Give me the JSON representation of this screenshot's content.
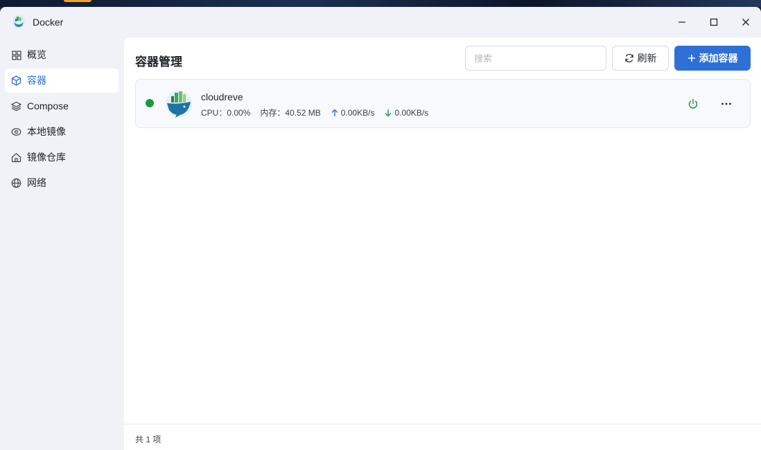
{
  "window": {
    "title": "Docker"
  },
  "sidebar": {
    "items": [
      {
        "label": "概览",
        "icon": "grid-icon",
        "active": false
      },
      {
        "label": "容器",
        "icon": "cube-icon",
        "active": true
      },
      {
        "label": "Compose",
        "icon": "layers-icon",
        "active": false
      },
      {
        "label": "本地镜像",
        "icon": "disc-icon",
        "active": false
      },
      {
        "label": "镜像仓库",
        "icon": "home-icon",
        "active": false
      },
      {
        "label": "网络",
        "icon": "globe-icon",
        "active": false
      }
    ]
  },
  "main": {
    "title": "容器管理",
    "search": {
      "placeholder": "搜索",
      "value": ""
    },
    "refresh_label": "刷新",
    "add_label": "添加容器"
  },
  "containers": [
    {
      "name": "cloudreve",
      "status": "running",
      "cpu": "CPU：0.00%",
      "memory": "内存：40.52 MB",
      "upload": "0.00KB/s",
      "download": "0.00KB/s"
    }
  ],
  "footer": {
    "count_text": "共 1 项"
  },
  "colors": {
    "accent": "#2f6fd8",
    "status_running": "#1a9a3a",
    "active_nav_text": "#2a6fd6"
  }
}
